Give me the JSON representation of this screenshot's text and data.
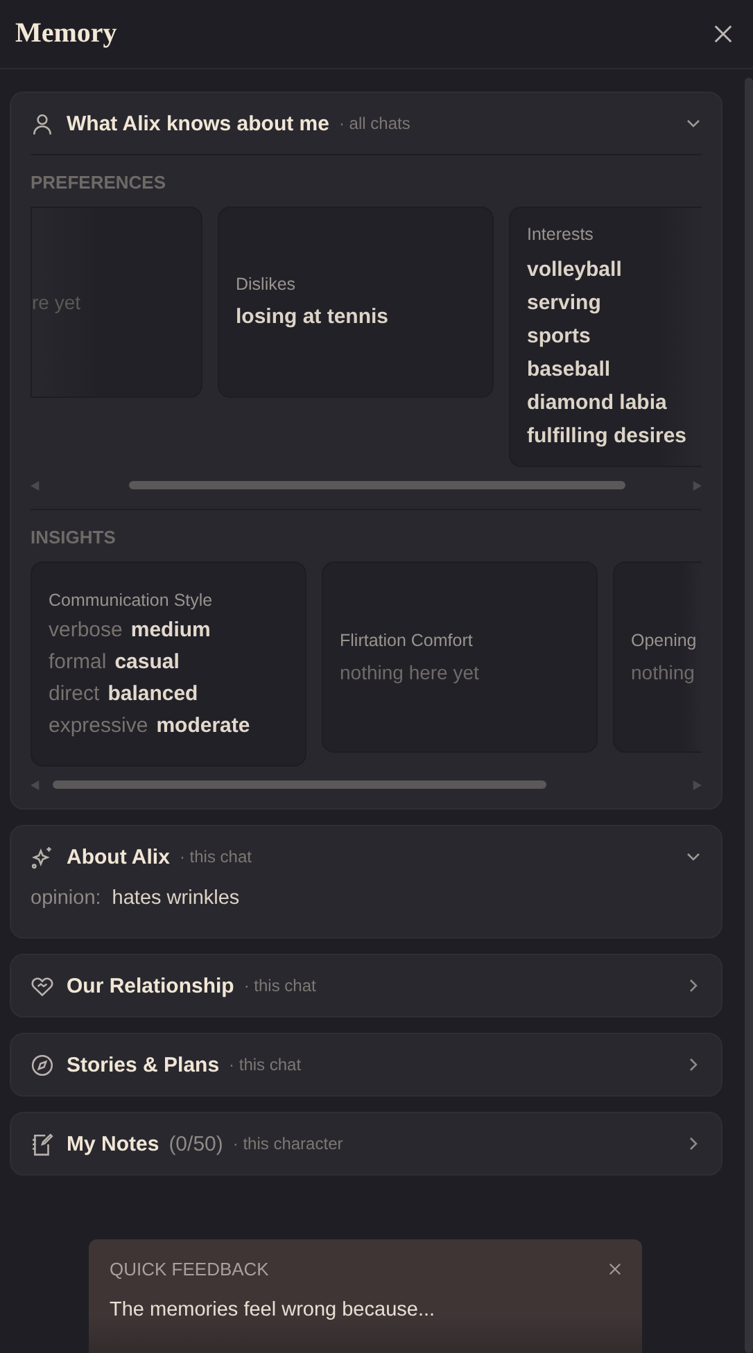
{
  "header": {
    "title": "Memory"
  },
  "sections": [
    {
      "kind": "knows",
      "title": "What Alix knows about me",
      "scope": "· all chats",
      "expanded": true,
      "groups": [
        {
          "label": "PREFERENCES",
          "cards": [
            {
              "kind": "empty",
              "text": "re yet"
            },
            {
              "kind": "list",
              "label": "Dislikes",
              "items": [
                "losing at tennis"
              ]
            },
            {
              "kind": "list",
              "label": "Interests",
              "items": [
                "volleyball",
                "serving",
                "sports",
                "baseball",
                "diamond labia",
                "fulfilling desires"
              ]
            }
          ]
        },
        {
          "label": "INSIGHTS",
          "cards": [
            {
              "kind": "pairs",
              "label": "Communication Style",
              "pairs": [
                {
                  "key": "verbose",
                  "value": "medium"
                },
                {
                  "key": "formal",
                  "value": "casual"
                },
                {
                  "key": "direct",
                  "value": "balanced"
                },
                {
                  "key": "expressive",
                  "value": "moderate"
                }
              ]
            },
            {
              "kind": "empty",
              "label": "Flirtation Comfort",
              "text": "nothing here yet"
            },
            {
              "kind": "empty",
              "label": "Opening",
              "text": "nothing"
            }
          ]
        }
      ]
    },
    {
      "kind": "facts",
      "title": "About Alix",
      "scope": "· this chat",
      "expanded": true,
      "facts": [
        {
          "key": "opinion:",
          "value": "hates wrinkles"
        }
      ]
    },
    {
      "kind": "link",
      "title": "Our Relationship",
      "scope": "· this chat",
      "expanded": false
    },
    {
      "kind": "link",
      "title": "Stories & Plans",
      "scope": "· this chat",
      "expanded": false
    },
    {
      "kind": "link",
      "title": "My Notes",
      "count": "(0/50)",
      "scope": "· this character",
      "expanded": false
    }
  ],
  "feedback": {
    "title": "QUICK FEEDBACK",
    "prompt": "The memories feel wrong because..."
  }
}
